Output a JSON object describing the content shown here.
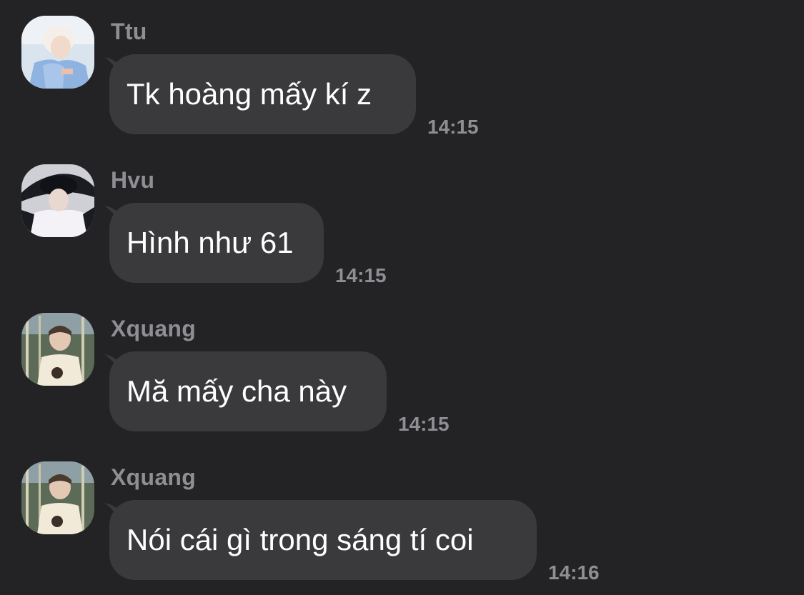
{
  "messages": [
    {
      "sender": "Ttu",
      "text": "Tk hoàng mấy kí z",
      "time": "14:15",
      "avatar": "avatar-ttu"
    },
    {
      "sender": "Hvu",
      "text": "Hình như 61",
      "time": "14:15",
      "avatar": "avatar-hvu"
    },
    {
      "sender": "Xquang",
      "text": "Mă mấy cha này",
      "time": "14:15",
      "avatar": "avatar-xquang"
    },
    {
      "sender": "Xquang",
      "text": "Nói cái gì trong sáng tí coi",
      "time": "14:16",
      "avatar": "avatar-xquang"
    }
  ],
  "colors": {
    "background": "#232325",
    "bubble": "#3a3a3c",
    "meta_text": "#8e8e93",
    "message_text": "#ffffff"
  }
}
